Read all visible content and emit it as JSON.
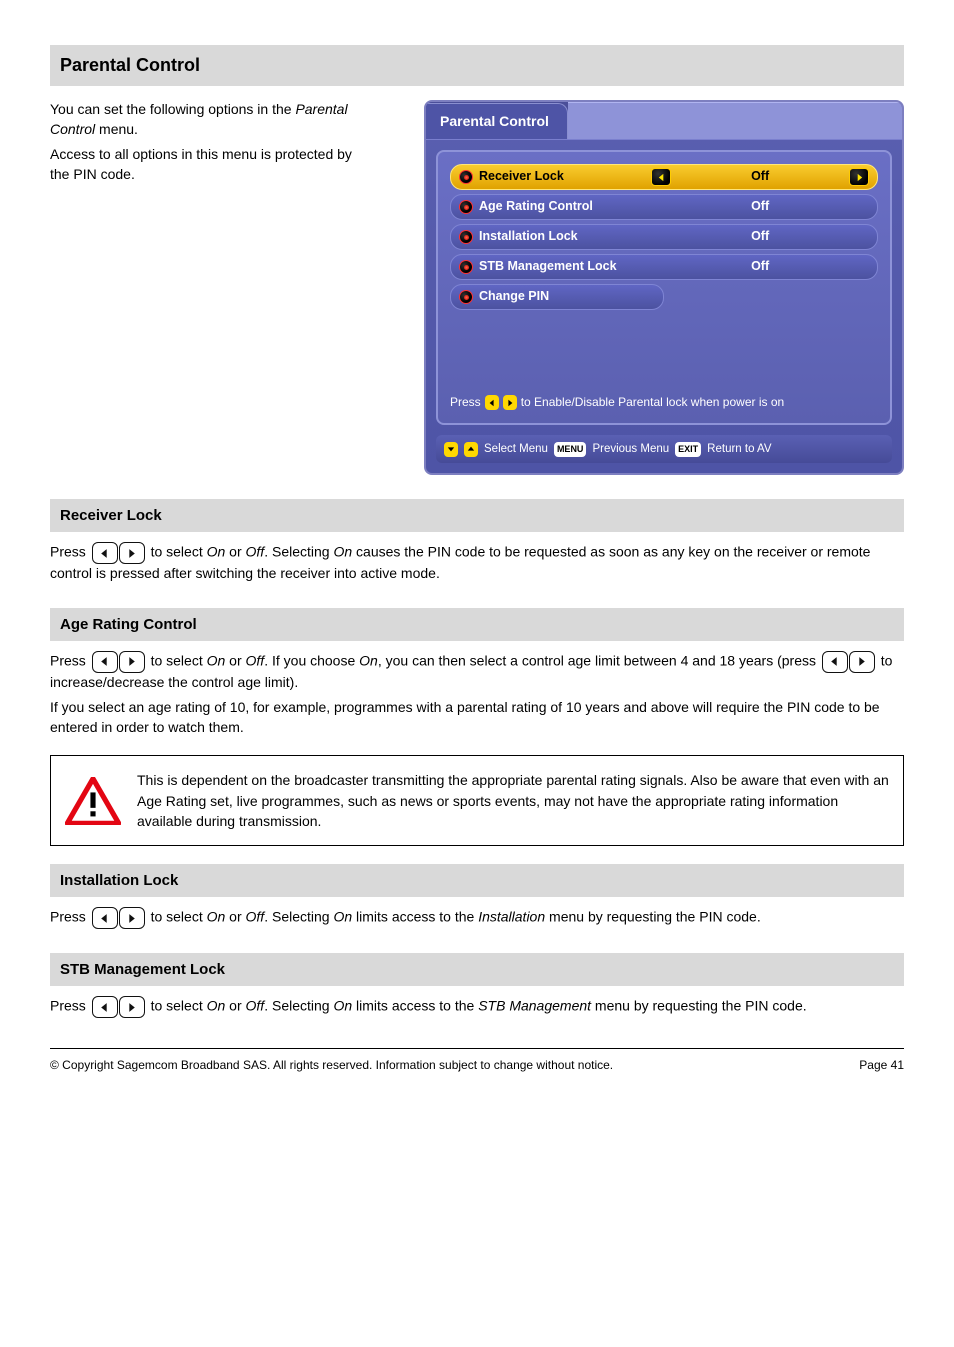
{
  "header": {
    "title": "Parental Control"
  },
  "intro": {
    "line1": "You can set the following options in the ",
    "line1_menu": "Parental Control",
    "line1_suffix": " menu.",
    "line2": "Access to all options in this menu is protected by the PIN code."
  },
  "screenshot": {
    "tab": "Parental Control",
    "rows": [
      {
        "label": "Receiver Lock",
        "value": "Off",
        "selected": true,
        "arrows": true
      },
      {
        "label": "Age Rating Control",
        "value": "Off",
        "selected": false,
        "arrows": false
      },
      {
        "label": "Installation Lock",
        "value": "Off",
        "selected": false,
        "arrows": false
      },
      {
        "label": "STB Management Lock",
        "value": "Off",
        "selected": false,
        "arrows": false
      },
      {
        "label": "Change PIN",
        "value": "",
        "selected": false,
        "arrows": false
      }
    ],
    "hint_prefix": "Press",
    "hint_suffix": "to Enable/Disable Parental lock when power is on",
    "footer_select": "Select Menu",
    "footer_prev": "Previous Menu",
    "footer_return": "Return to AV",
    "pill_menu": "MENU",
    "pill_exit": "EXIT"
  },
  "receiver_lock": {
    "heading": "Receiver Lock",
    "p_prefix": "Press ",
    "p_mid": " to select ",
    "on": "On",
    "or": " or ",
    "off": "Off",
    "suffix1": ". Selecting ",
    "suffix2": " causes the PIN code to be requested as soon as any key on the receiver or remote control is pressed after switching the receiver into active mode."
  },
  "age_rating": {
    "heading": "Age Rating Control",
    "p1a": "Press ",
    "p1b": " to select ",
    "p1c": ". If you choose ",
    "p1d": ", you can then select a control age limit between 4 and 18 years (press ",
    "p1e": " to increase/decrease the control age limit).",
    "p2": "If you select an age rating of 10, for example, programmes with a parental rating of 10 years and above will require the PIN code to be entered in order to watch them."
  },
  "note": {
    "body": "This is dependent on the broadcaster transmitting the appropriate parental rating signals. Also be aware that even with an Age Rating set, live programmes, such as news or sports events, may not have the appropriate rating information available during transmission."
  },
  "install_lock": {
    "heading": "Installation Lock",
    "p_prefix": "Press ",
    "p_mid": " to select ",
    "suffix1": ". Selecting ",
    "suffix2": " limits access to the ",
    "menu_name": "Installation",
    "suffix3": " menu by requesting the PIN code."
  },
  "stb_lock": {
    "heading": "STB Management Lock",
    "p_prefix": "Press ",
    "p_mid": " to select ",
    "suffix1": ". Selecting ",
    "suffix2": " limits access to the ",
    "menu_name": "STB Management",
    "suffix3": " menu by requesting the PIN code."
  },
  "footer": {
    "left": "© Copyright Sagemcom Broadband SAS. All rights reserved. Information subject to change without notice.",
    "right": "Page 41"
  }
}
